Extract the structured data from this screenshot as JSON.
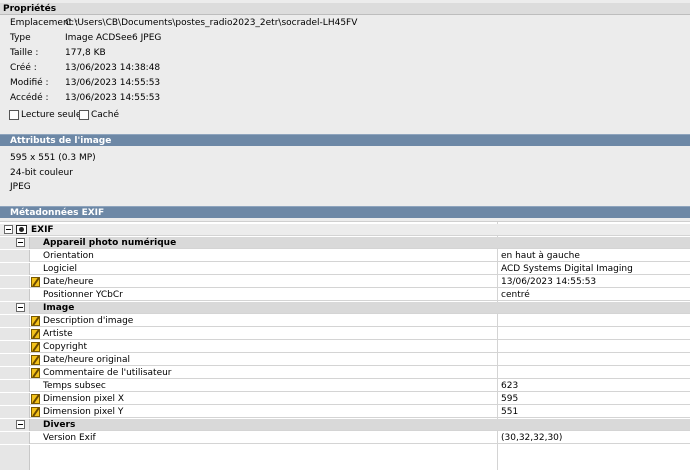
{
  "properties": {
    "header": "Propriétés",
    "rows": [
      {
        "label": "Emplacement :",
        "value": "C:\\Users\\CB\\Documents\\postes_radio2023_2etr\\socradel-LH45FV"
      },
      {
        "label": "Type",
        "value": "Image ACDSee6 JPEG"
      },
      {
        "label": "Taille :",
        "value": "177,8 KB"
      },
      {
        "label": "Créé :",
        "value": "13/06/2023 14:38:48"
      },
      {
        "label": "Modifié :",
        "value": "13/06/2023 14:55:53"
      },
      {
        "label": "Accédé :",
        "value": "13/06/2023 14:55:53"
      }
    ],
    "checkboxes": [
      {
        "label": "Lecture seule",
        "checked": false
      },
      {
        "label": "Caché",
        "checked": false
      }
    ]
  },
  "image_attributes": {
    "header": "Attributs de l'image",
    "lines": [
      "595 x 551 (0.3 MP)",
      "24-bit couleur",
      "JPEG"
    ]
  },
  "metadata": {
    "header": "Métadonnées EXIF",
    "root_label": "EXIF",
    "groups": [
      {
        "name": "Appareil photo numérique",
        "rows": [
          {
            "name": "Orientation",
            "value": "en haut à gauche",
            "icon": ""
          },
          {
            "name": "Logiciel",
            "value": "ACD Systems Digital Imaging",
            "icon": ""
          },
          {
            "name": "Date/heure",
            "value": "13/06/2023 14:55:53",
            "icon": "pencil-icon"
          },
          {
            "name": "Positionner YCbCr",
            "value": "centré",
            "icon": ""
          }
        ]
      },
      {
        "name": "Image",
        "rows": [
          {
            "name": "Description d'image",
            "value": "",
            "icon": "pencil-icon"
          },
          {
            "name": "Artiste",
            "value": "",
            "icon": "pencil-icon"
          },
          {
            "name": "Copyright",
            "value": "",
            "icon": "pencil-icon"
          },
          {
            "name": "Date/heure original",
            "value": "",
            "icon": "pencil-icon"
          },
          {
            "name": "Commentaire de l'utilisateur",
            "value": "",
            "icon": "pencil-icon"
          },
          {
            "name": "Temps subsec",
            "value": "623",
            "icon": ""
          },
          {
            "name": "Dimension pixel X",
            "value": "595",
            "icon": "pencil-icon"
          },
          {
            "name": "Dimension pixel Y",
            "value": "551",
            "icon": "pencil-icon"
          }
        ]
      },
      {
        "name": "Divers",
        "rows": [
          {
            "name": "Version Exif",
            "value": "(30,32,32,30)",
            "icon": ""
          }
        ]
      }
    ]
  }
}
